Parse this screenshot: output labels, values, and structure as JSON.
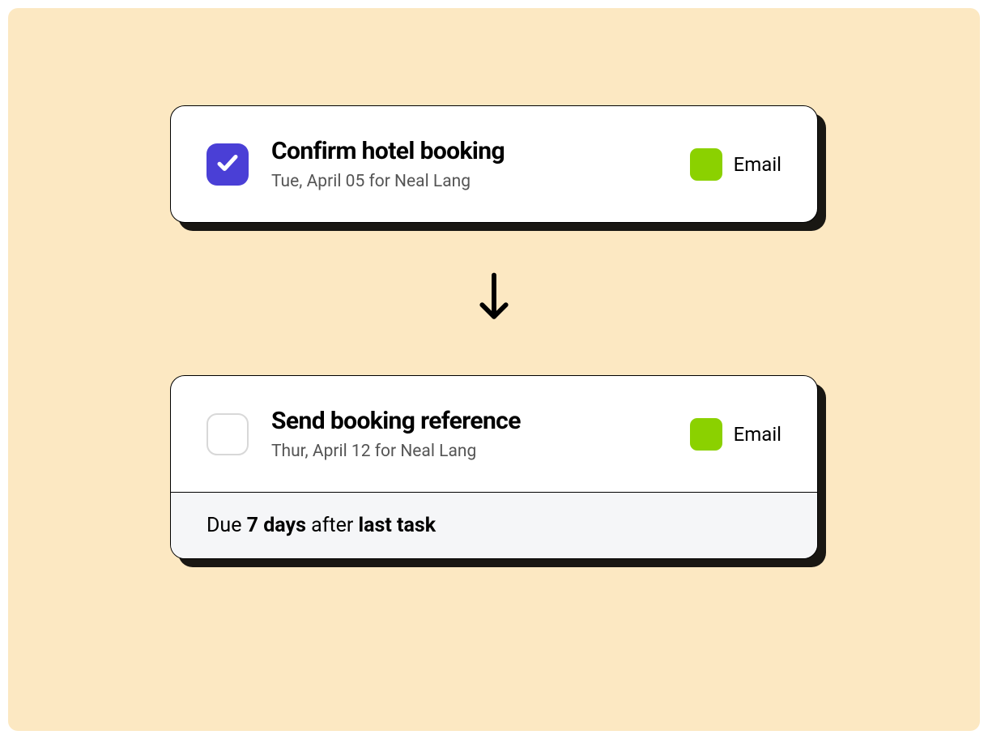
{
  "tasks": [
    {
      "title": "Confirm hotel booking",
      "subtitle": "Tue, April 05 for Neal Lang",
      "checked": true,
      "tag_label": "Email",
      "tag_color": "#8bd100"
    },
    {
      "title": "Send booking reference",
      "subtitle": "Thur, April 12 for Neal Lang",
      "checked": false,
      "tag_label": "Email",
      "tag_color": "#8bd100"
    }
  ],
  "due_rule": {
    "prefix": "Due ",
    "days": "7 days",
    "mid": " after ",
    "anchor": "last task"
  },
  "colors": {
    "background": "#fce8c2",
    "checkbox_checked": "#4a3fd6",
    "tag_green": "#8bd100"
  }
}
